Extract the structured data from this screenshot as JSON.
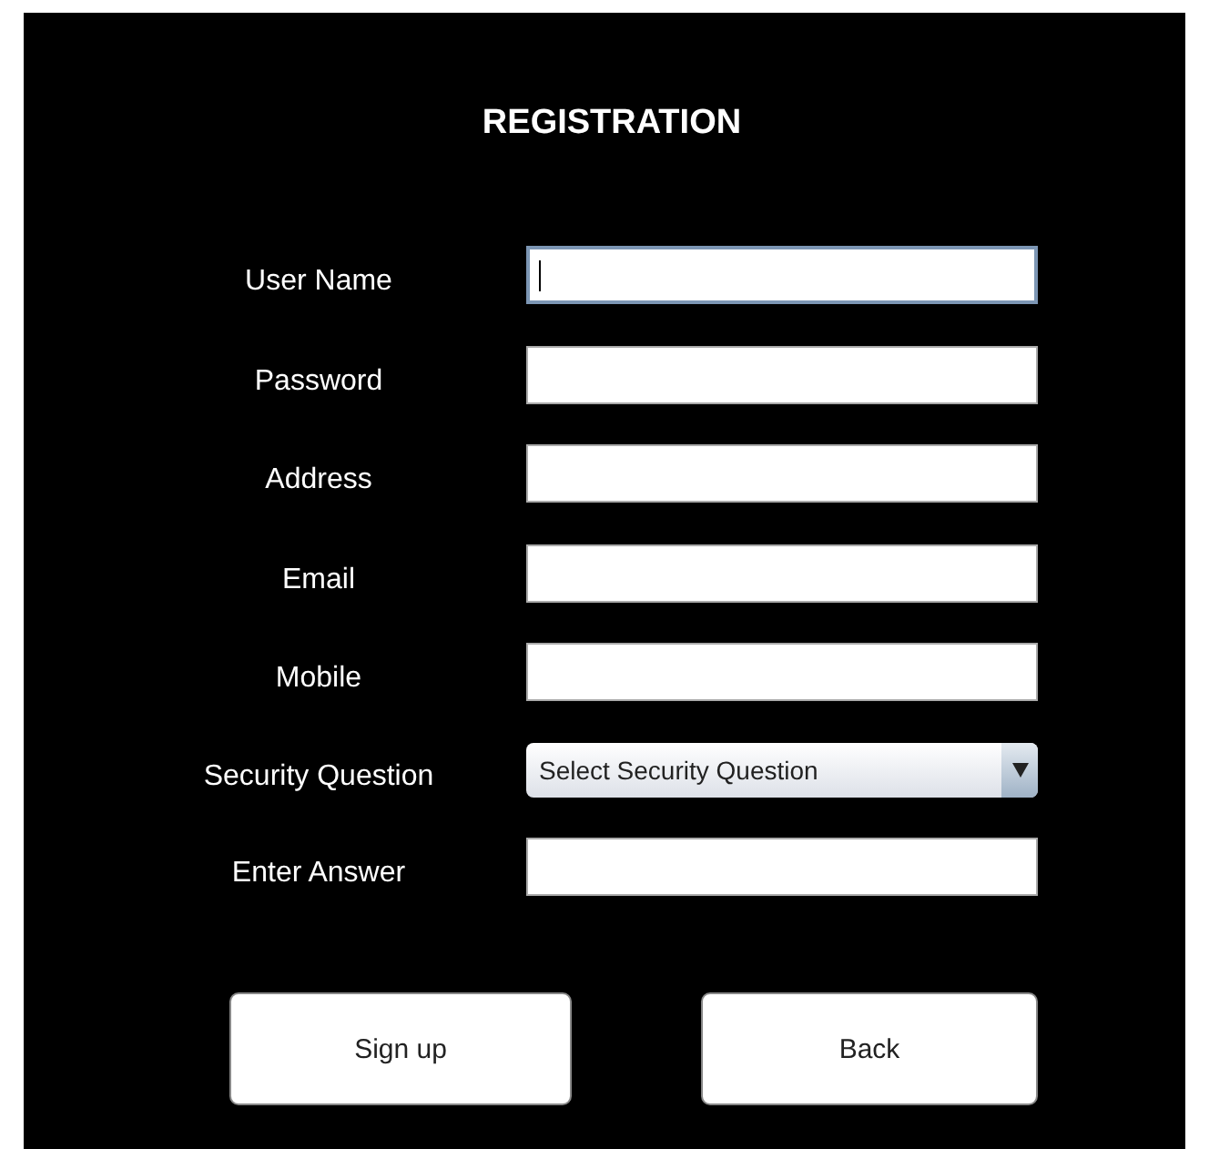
{
  "title": "REGISTRATION",
  "fields": [
    {
      "label": "User Name",
      "kind": "text",
      "focused": true
    },
    {
      "label": "Password",
      "kind": "text",
      "focused": false
    },
    {
      "label": "Address",
      "kind": "text",
      "focused": false
    },
    {
      "label": "Email",
      "kind": "text",
      "focused": false
    },
    {
      "label": "Mobile",
      "kind": "text",
      "focused": false
    },
    {
      "label": "Security Question",
      "kind": "select",
      "value": "Select Security Question",
      "focused": false
    },
    {
      "label": "Enter Answer",
      "kind": "text",
      "focused": false
    }
  ],
  "buttons": [
    "Sign up",
    "Back"
  ]
}
